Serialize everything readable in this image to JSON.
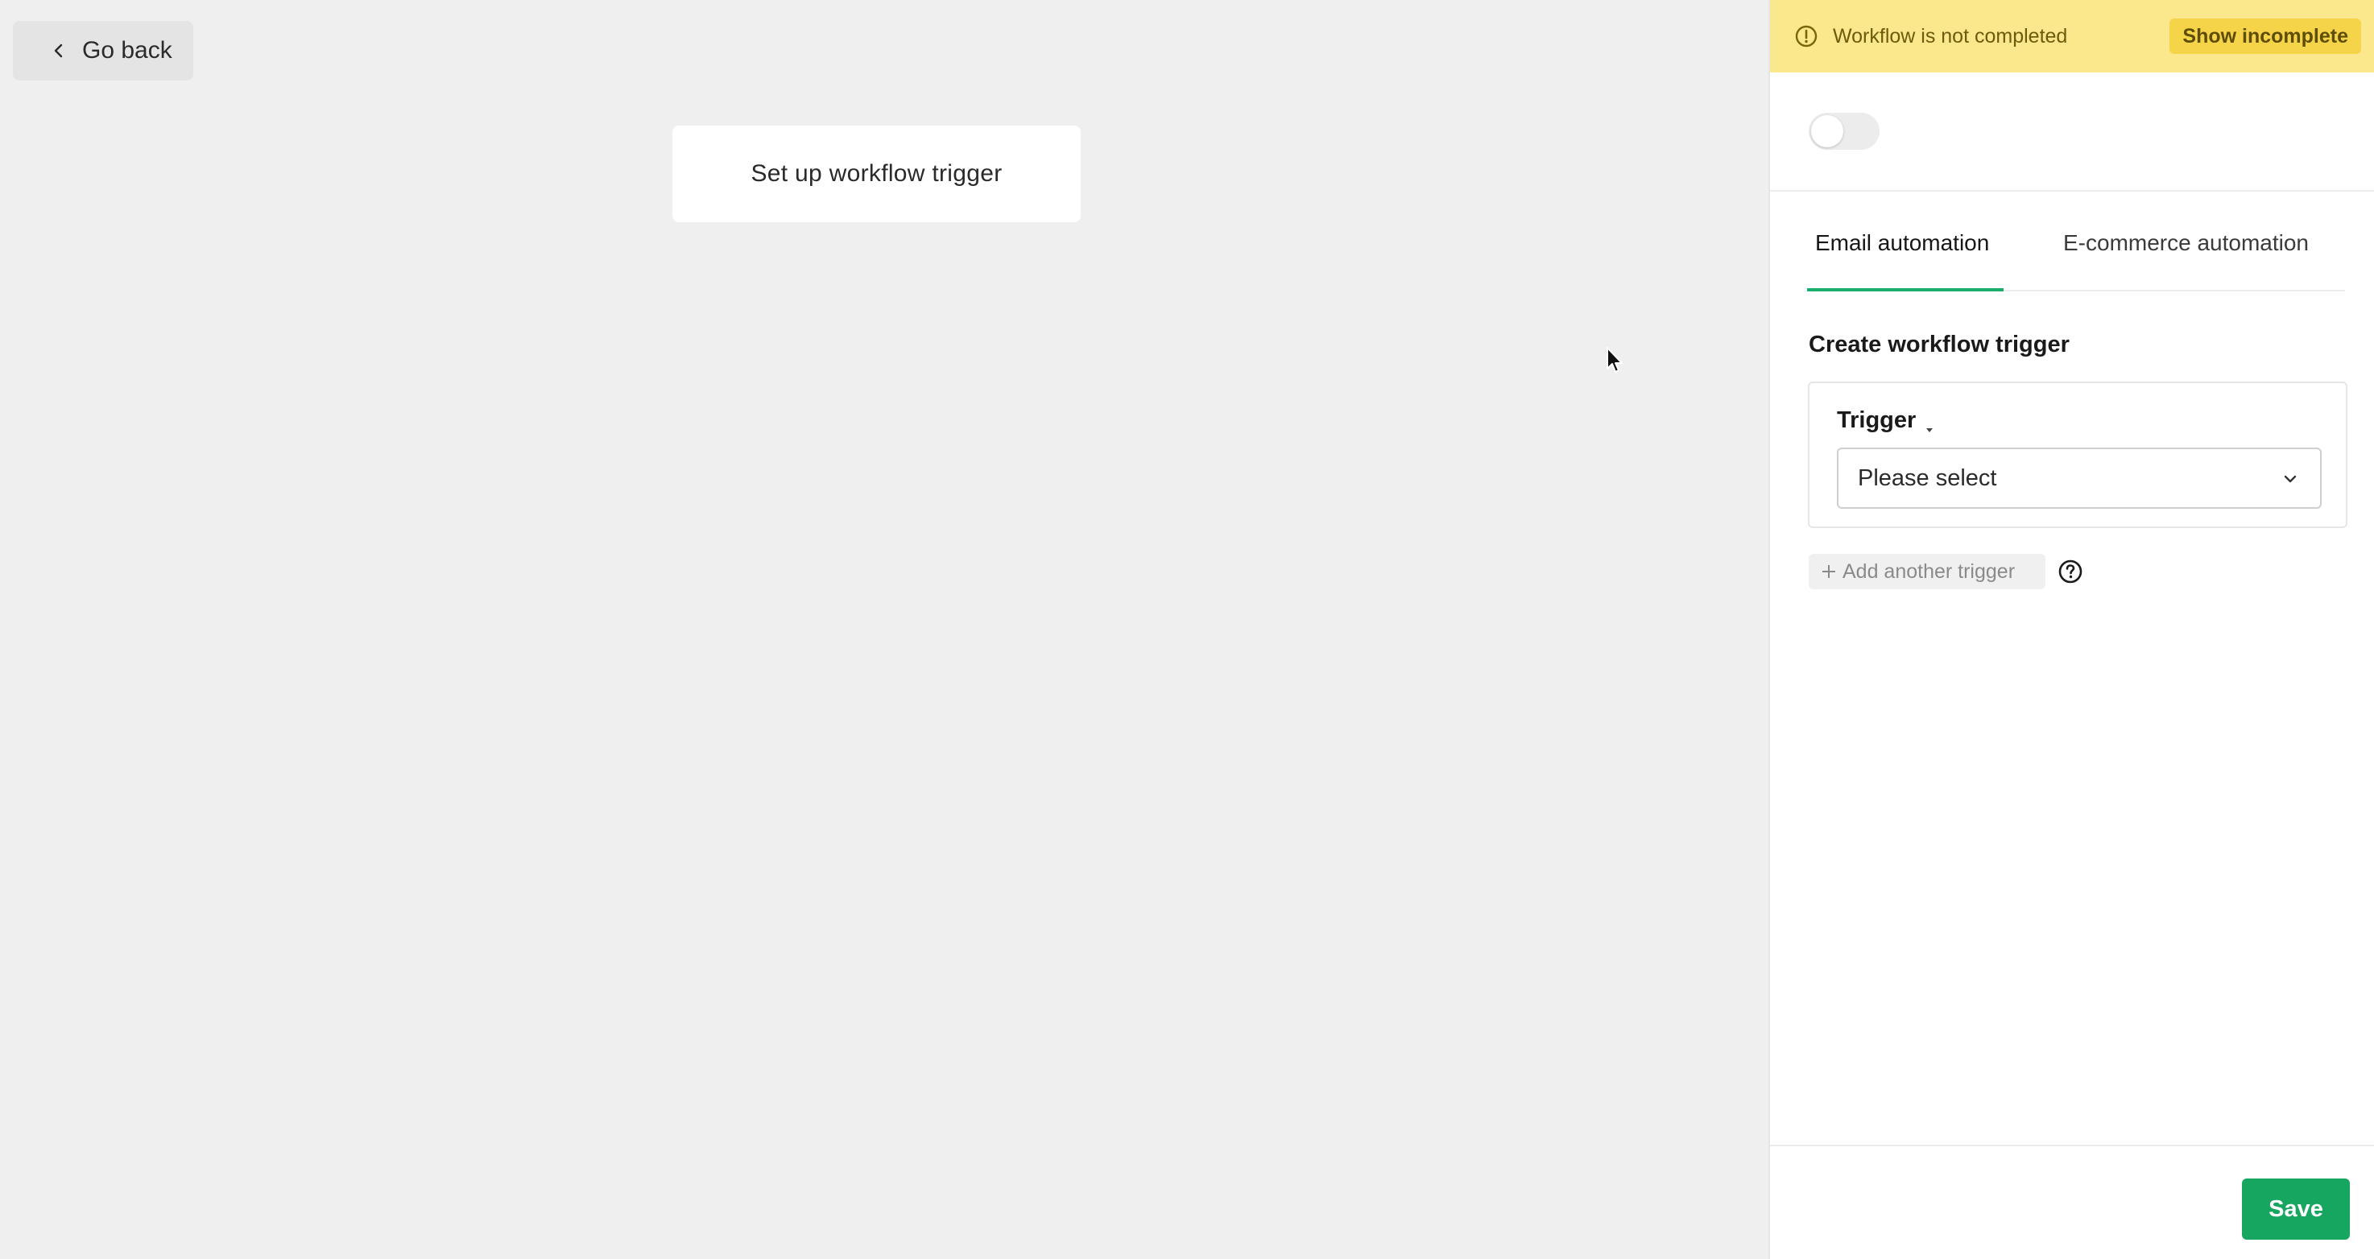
{
  "canvas": {
    "go_back_label": "Go back",
    "trigger_node_label": "Set up workflow trigger"
  },
  "banner": {
    "message": "Workflow is not completed",
    "show_incomplete_label": "Show incomplete",
    "icon": "warning-circle-icon"
  },
  "panel": {
    "toggle_on": false,
    "tabs": [
      {
        "label": "Email automation",
        "active": true
      },
      {
        "label": "E-commerce automation",
        "active": false
      }
    ],
    "section_title": "Create workflow trigger",
    "trigger": {
      "label": "Trigger",
      "select_value": "Please select"
    },
    "add_trigger_label": "Add another trigger",
    "save_label": "Save"
  },
  "colors": {
    "accent": "#17a65f",
    "banner_bg": "#fbe88c",
    "banner_button_bg": "#f6d44a",
    "canvas_bg": "#efeff0"
  }
}
